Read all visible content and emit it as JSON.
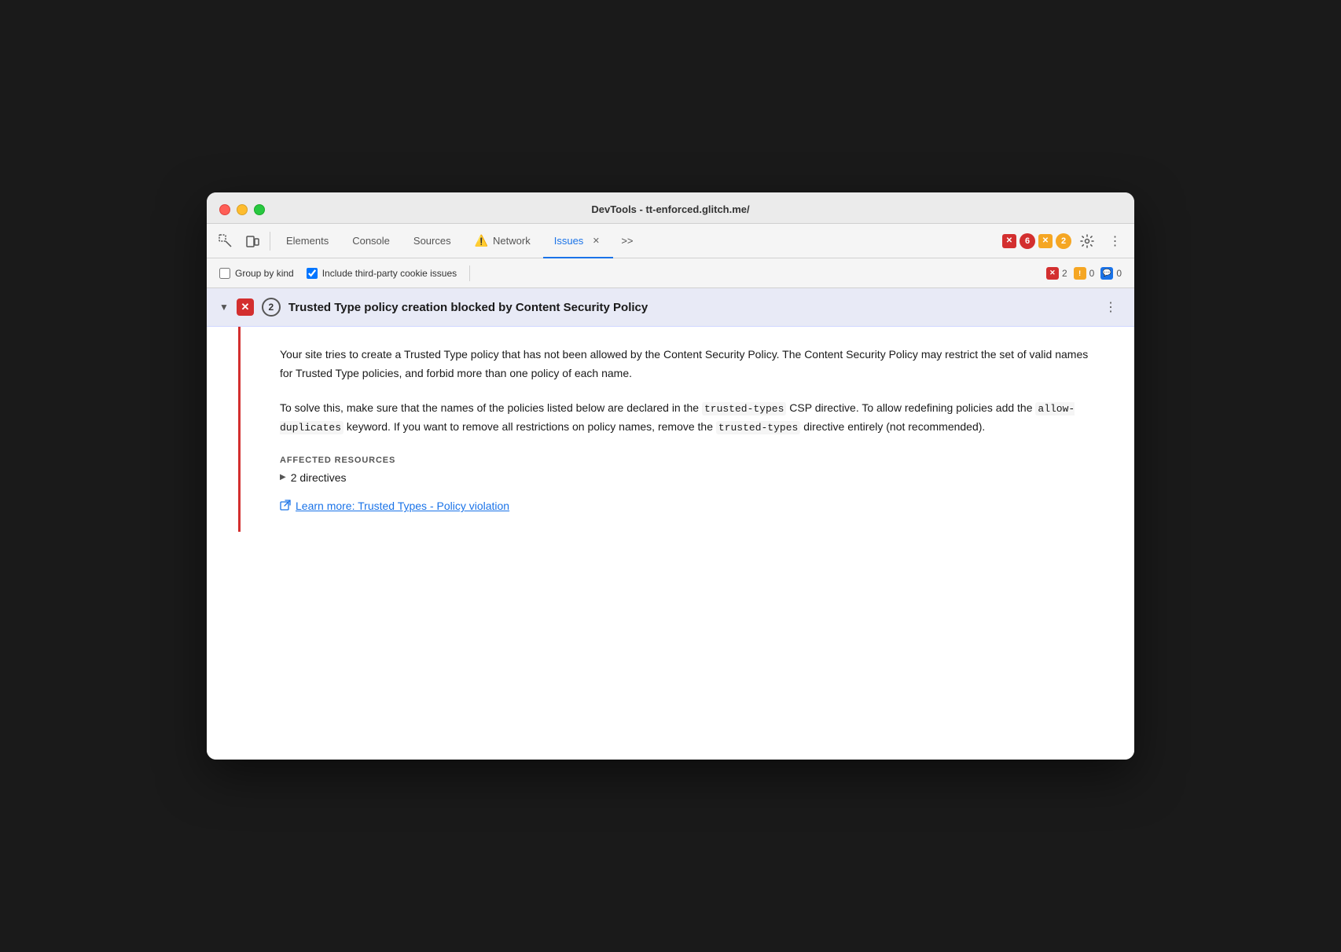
{
  "window": {
    "title": "DevTools - tt-enforced.glitch.me/"
  },
  "toolbar": {
    "tabs": [
      {
        "id": "elements",
        "label": "Elements",
        "active": false
      },
      {
        "id": "console",
        "label": "Console",
        "active": false
      },
      {
        "id": "sources",
        "label": "Sources",
        "active": false
      },
      {
        "id": "network",
        "label": "Network",
        "active": false,
        "hasWarning": true
      },
      {
        "id": "issues",
        "label": "Issues",
        "active": true,
        "hasClose": true
      }
    ],
    "overflow_label": ">>",
    "error_count": "6",
    "warning_count": "2",
    "settings_title": "Settings",
    "more_title": "More options"
  },
  "subbar": {
    "group_by_kind_label": "Group by kind",
    "group_by_kind_checked": false,
    "include_third_party_label": "Include third-party cookie issues",
    "include_third_party_checked": true,
    "error_badge_count": "2",
    "warning_badge_count": "0",
    "info_badge_count": "0"
  },
  "issue": {
    "title": "Trusted Type policy creation blocked by Content Security Policy",
    "count": "2",
    "description": "Your site tries to create a Trusted Type policy that has not been allowed by the Content Security Policy. The Content Security Policy may restrict the set of valid names for Trusted Type policies, and forbid more than one policy of each name.",
    "solution_part1": "To solve this, make sure that the names of the policies listed below are declared in the ",
    "solution_code1": "trusted-types",
    "solution_part2": " CSP directive. To allow redefining policies add the ",
    "solution_code2": "allow-duplicates",
    "solution_part3": " keyword. If you want to remove all restrictions on policy names, remove the ",
    "solution_code3": "trusted-types",
    "solution_part4": " directive entirely (not recommended).",
    "affected_resources_label": "AFFECTED RESOURCES",
    "directives_label": "2 directives",
    "learn_more_label": "Learn more: Trusted Types - Policy violation"
  }
}
